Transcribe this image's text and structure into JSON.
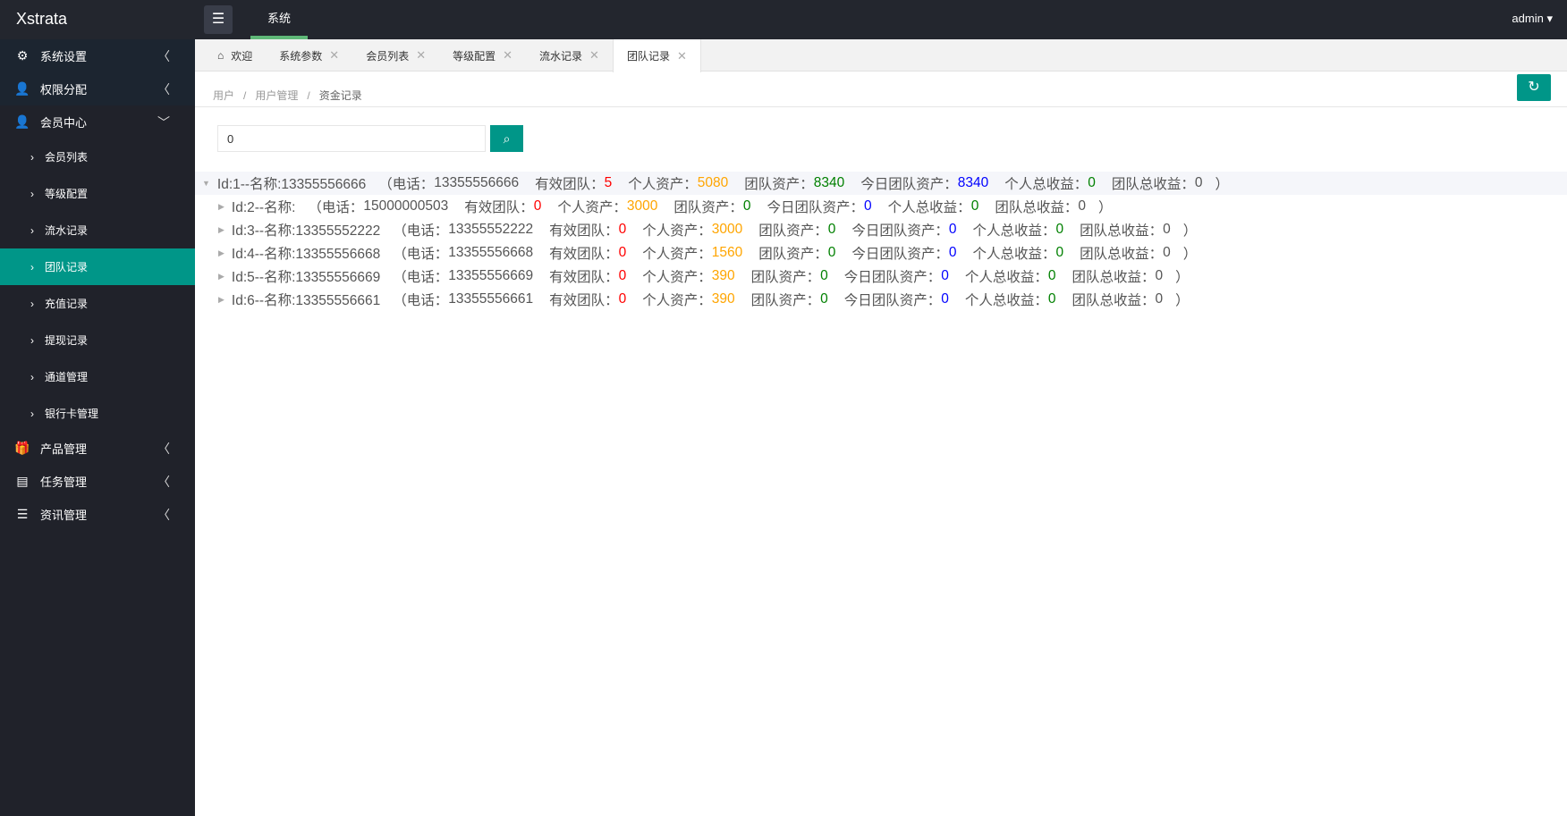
{
  "app": {
    "title": "Xstrata",
    "top_nav": "系统",
    "user": "admin"
  },
  "sidebar": [
    {
      "label": "系统设置",
      "icon": "gear-icon",
      "expanded": false
    },
    {
      "label": "权限分配",
      "icon": "user-icon",
      "expanded": false
    },
    {
      "label": "会员中心",
      "icon": "user-icon",
      "expanded": true,
      "children": [
        "会员列表",
        "等级配置",
        "流水记录",
        "团队记录",
        "充值记录",
        "提现记录",
        "通道管理",
        "银行卡管理"
      ],
      "active_child": 3
    },
    {
      "label": "产品管理",
      "icon": "gift-icon",
      "expanded": false
    },
    {
      "label": "任务管理",
      "icon": "task-icon",
      "expanded": false
    },
    {
      "label": "资讯管理",
      "icon": "news-icon",
      "expanded": false
    }
  ],
  "tabs": [
    {
      "label": "欢迎",
      "closable": false
    },
    {
      "label": "系统参数",
      "closable": true
    },
    {
      "label": "会员列表",
      "closable": true
    },
    {
      "label": "等级配置",
      "closable": true
    },
    {
      "label": "流水记录",
      "closable": true
    },
    {
      "label": "团队记录",
      "closable": true,
      "active": true
    }
  ],
  "breadcrumb": [
    "用户",
    "用户管理",
    "资金记录"
  ],
  "search": {
    "value": "0"
  },
  "labels": {
    "phone": "（电话：",
    "valid_team": "有效团队：",
    "personal_assets": "个人资产：",
    "team_assets": "团队资产：",
    "today_team_assets": "今日团队资产：",
    "personal_income": "个人总收益：",
    "team_income": "团队总收益：",
    "close": "）"
  },
  "records": [
    {
      "head": "Id:1--名称:13355556666",
      "phone": "13355556666",
      "valid_team": "5",
      "personal_assets": "5080",
      "team_assets": "8340",
      "today_team_assets": "8340",
      "personal_income": "0",
      "team_income": "0",
      "expanded": true
    },
    {
      "head": "Id:2--名称:",
      "phone": "15000000503",
      "valid_team": "0",
      "personal_assets": "3000",
      "team_assets": "0",
      "today_team_assets": "0",
      "personal_income": "0",
      "team_income": "0"
    },
    {
      "head": "Id:3--名称:13355552222",
      "phone": "13355552222",
      "valid_team": "0",
      "personal_assets": "3000",
      "team_assets": "0",
      "today_team_assets": "0",
      "personal_income": "0",
      "team_income": "0"
    },
    {
      "head": "Id:4--名称:13355556668",
      "phone": "13355556668",
      "valid_team": "0",
      "personal_assets": "1560",
      "team_assets": "0",
      "today_team_assets": "0",
      "personal_income": "0",
      "team_income": "0"
    },
    {
      "head": "Id:5--名称:13355556669",
      "phone": "13355556669",
      "valid_team": "0",
      "personal_assets": "390",
      "team_assets": "0",
      "today_team_assets": "0",
      "personal_income": "0",
      "team_income": "0"
    },
    {
      "head": "Id:6--名称:13355556661",
      "phone": "13355556661",
      "valid_team": "0",
      "personal_assets": "390",
      "team_assets": "0",
      "today_team_assets": "0",
      "personal_income": "0",
      "team_income": "0"
    }
  ],
  "colors": {
    "accent": "#009688",
    "nav_indicator": "#5fb878",
    "valid_team": "#ff0000",
    "personal_assets": "#ffa500",
    "team_assets": "#008000",
    "today_team_assets": "#0000ff",
    "personal_income": "#008000"
  }
}
